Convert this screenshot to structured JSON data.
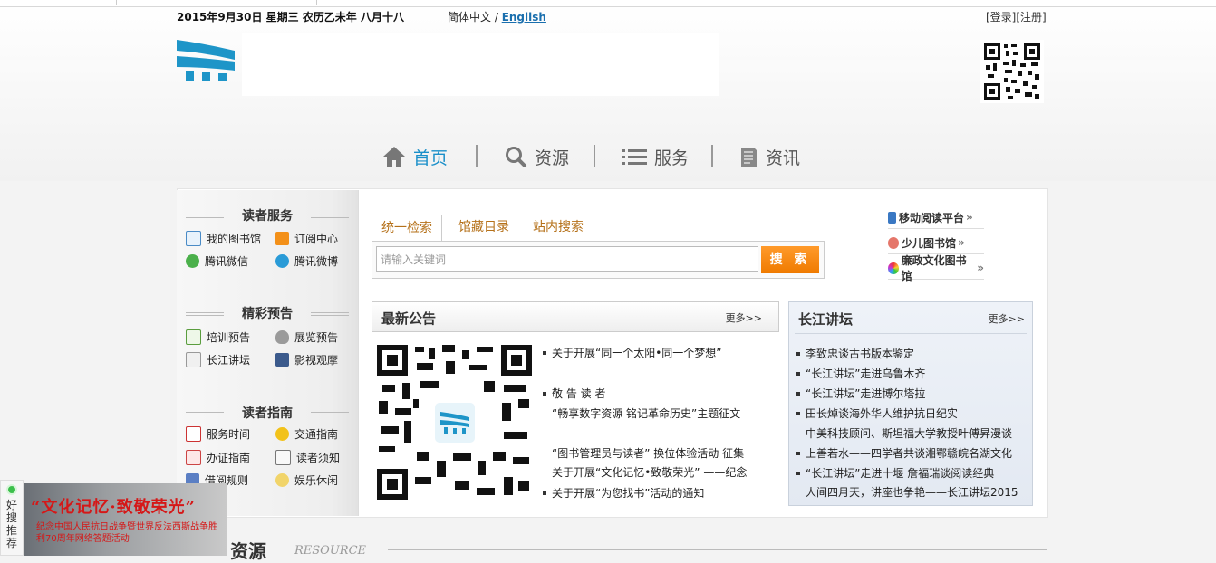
{
  "topbar": {
    "date": "2015年9月30日  星期三  农历乙未年  八月十八",
    "lang_zh": "简体中文 / ",
    "lang_en": "English",
    "login": "[登录]",
    "register": "[注册]"
  },
  "nav": [
    {
      "label": "首页",
      "icon": "home-icon"
    },
    {
      "label": "资源",
      "icon": "search-icon"
    },
    {
      "label": "服务",
      "icon": "list-icon"
    },
    {
      "label": "资讯",
      "icon": "document-icon"
    }
  ],
  "sidebar": {
    "sections": [
      {
        "title": "读者服务",
        "items": [
          "我的图书馆",
          "订阅中心",
          "腾讯微信",
          "腾讯微博"
        ]
      },
      {
        "title": "精彩预告",
        "items": [
          "培训预告",
          "展览预告",
          "长江讲坛",
          "影视观摩"
        ]
      },
      {
        "title": "读者指南",
        "items": [
          "服务时间",
          "交通指南",
          "办证指南",
          "读者须知",
          "借阅规则",
          "娱乐休闲"
        ]
      }
    ]
  },
  "search": {
    "tabs": [
      "统一检索",
      "馆藏目录",
      "站内搜索"
    ],
    "placeholder": "请输入关键词",
    "button": "搜 索"
  },
  "quick_links": [
    "移动阅读平台",
    "少儿图书馆",
    "廉政文化图书馆"
  ],
  "quick_arrow": "»",
  "notices": {
    "title": "最新公告",
    "more": "更多>>",
    "items": [
      "关于开展“同一个太阳•同一个梦想”",
      "敬 告 读 者",
      "“畅享数字资源 铭记革命历史”主题征文",
      "“图书管理员与读者” 换位体验活动 征集",
      "关于开展“文化记忆•致敬荣光” ——纪念",
      "关于开展“为您找书”活动的通知"
    ]
  },
  "forum": {
    "title": "长江讲坛",
    "more": "更多>>",
    "items": [
      "李致忠谈古书版本鉴定",
      "“长江讲坛”走进乌鲁木齐",
      "“长江讲坛”走进博尔塔拉",
      "田长焯谈海外华人维护抗日纪实",
      "中美科技顾问、斯坦福大学教授叶傅昇漫谈",
      "上善若水——四学者共谈湘鄂赣皖名湖文化",
      "“长江讲坛”走进十堰  詹福瑞谈阅读经典",
      "人间四月天，讲座也争艳——长江讲坛2015"
    ]
  },
  "float_ad": {
    "side_label": "好搜推荐",
    "title": "“文化记忆·致敬荣光”",
    "subtitle": "纪念中国人民抗日战争暨世界反法西斯战争胜利70周年网络答题活动"
  },
  "resource": {
    "title": "资源",
    "subtitle": "RESOURCE"
  },
  "colors": {
    "accent": "#1a8fc9",
    "button": "#ef7a00",
    "tab": "#b5711a"
  }
}
